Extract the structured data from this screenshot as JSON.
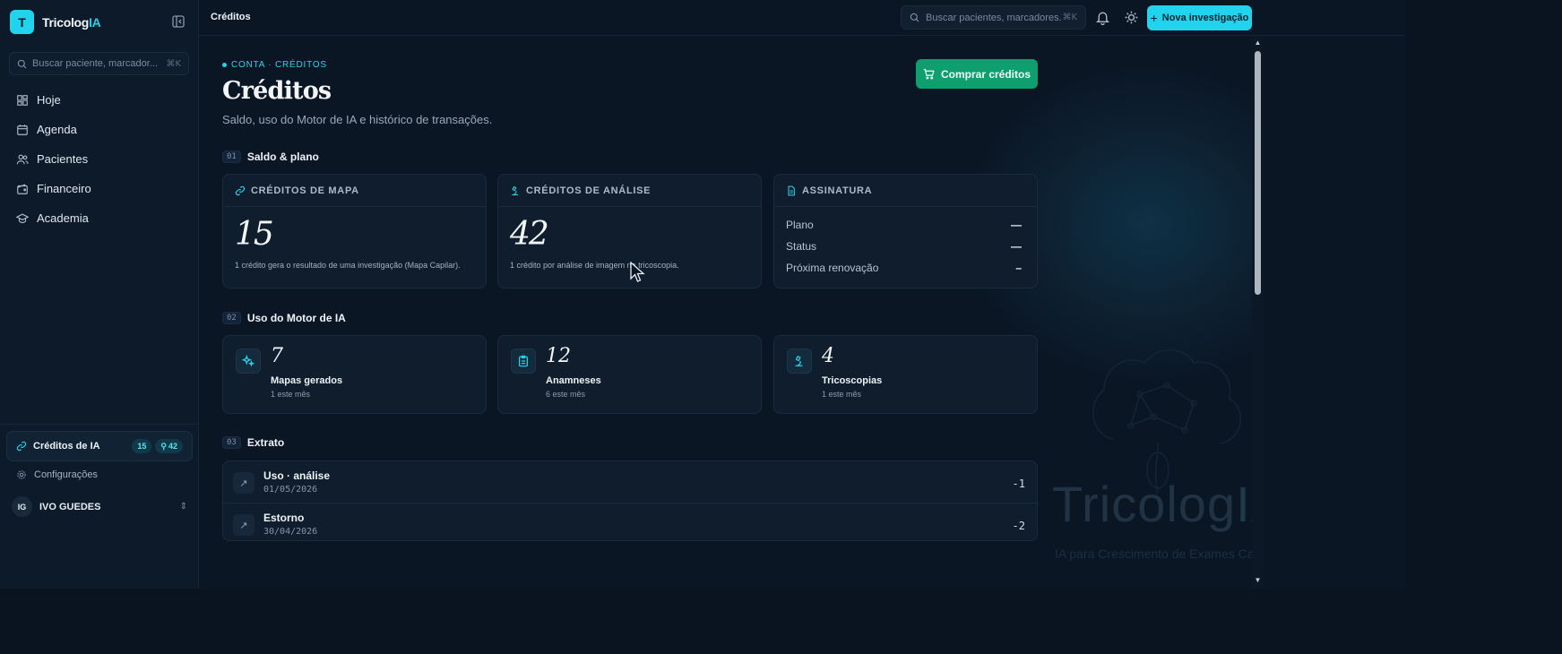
{
  "brand": {
    "logo_letter": "T",
    "name_main": "Tricolog",
    "name_accent": "IA"
  },
  "sidebar": {
    "search_placeholder": "Buscar paciente, marcador...",
    "search_shortcut": "⌘K",
    "nav": [
      {
        "label": "Hoje",
        "icon": "dashboard-icon"
      },
      {
        "label": "Agenda",
        "icon": "calendar-icon"
      },
      {
        "label": "Pacientes",
        "icon": "users-icon"
      },
      {
        "label": "Financeiro",
        "icon": "wallet-icon"
      },
      {
        "label": "Academia",
        "icon": "graduation-cap-icon"
      }
    ],
    "credits": {
      "label": "Créditos de IA",
      "map_count": "15",
      "analysis_count": "42"
    },
    "settings_label": "Configurações",
    "user": {
      "initials": "IG",
      "name": "IVO GUEDES"
    }
  },
  "topbar": {
    "title": "Créditos",
    "search_placeholder": "Buscar pacientes, marcadores...",
    "search_shortcut": "⌘K",
    "new_button": "Nova investigação"
  },
  "page": {
    "eyebrow": "CONTA · CRÉDITOS",
    "title": "Créditos",
    "subtitle": "Saldo, uso do Motor de IA e histórico de transações.",
    "buy_button": "Comprar créditos"
  },
  "sections": {
    "balance": {
      "num": "01",
      "title": "Saldo & plano"
    },
    "usage": {
      "num": "02",
      "title": "Uso do Motor de IA"
    },
    "statement": {
      "num": "03",
      "title": "Extrato"
    }
  },
  "balance_cards": {
    "map": {
      "title": "CRÉDITOS DE MAPA",
      "value": "15",
      "note": "1 crédito gera o resultado de uma investigação (Mapa Capilar)."
    },
    "analysis": {
      "title": "CRÉDITOS DE ANÁLISE",
      "value": "42",
      "note": "1 crédito por análise de imagem na tricoscopia."
    },
    "subscription": {
      "title": "ASSINATURA",
      "rows": [
        {
          "label": "Plano",
          "value": "—"
        },
        {
          "label": "Status",
          "value": "—"
        },
        {
          "label": "Próxima renovação",
          "value": "–"
        }
      ]
    }
  },
  "usage_cards": [
    {
      "value": "7",
      "label": "Mapas gerados",
      "meta": "1 este mês",
      "icon": "sparkles-icon"
    },
    {
      "value": "12",
      "label": "Anamneses",
      "meta": "6 este mês",
      "icon": "clipboard-icon"
    },
    {
      "value": "4",
      "label": "Tricoscopias",
      "meta": "1 este mês",
      "icon": "microscope-icon"
    }
  ],
  "transactions": [
    {
      "title": "Uso · análise",
      "date": "01/05/2026",
      "amount": "-1"
    },
    {
      "title": "Estorno",
      "date": "30/04/2026",
      "amount": "-2"
    }
  ],
  "watermark": {
    "main": "Tricolog",
    "accent": "IA",
    "tagline": "IA para Crescimento de Exames Capilares"
  },
  "colors": {
    "accent": "#22d3ee",
    "buy": "#0f9e6e",
    "background": "#0b1624"
  }
}
